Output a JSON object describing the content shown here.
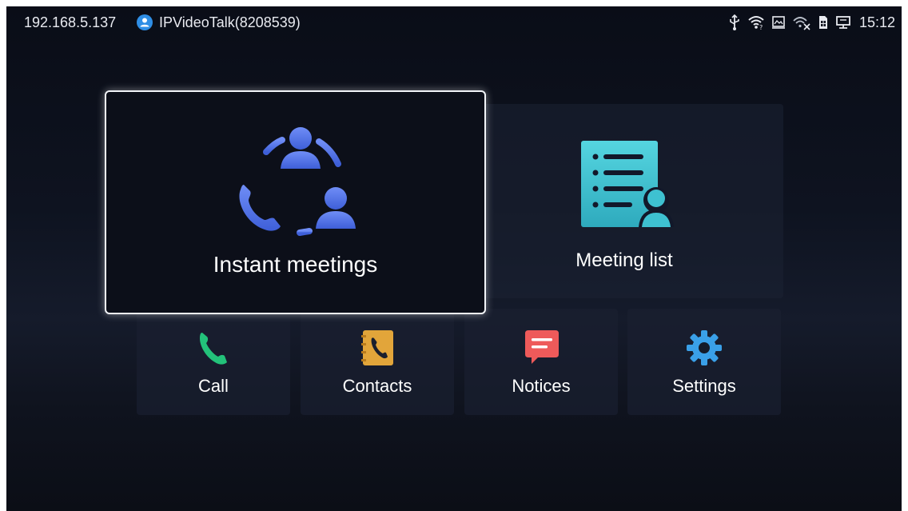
{
  "status_bar": {
    "ip_address": "192.168.5.137",
    "account_name": "IPVideoTalk(8208539)",
    "time": "15:12",
    "icons": [
      "usb-icon",
      "wifi-icon",
      "screen-icon",
      "wifi-off-icon",
      "sim-icon",
      "display-icon"
    ]
  },
  "tiles": {
    "instant_meetings": {
      "label": "Instant meetings",
      "icon": "instant-meetings-icon"
    },
    "meeting_list": {
      "label": "Meeting list",
      "icon": "meeting-list-icon"
    },
    "call": {
      "label": "Call",
      "icon": "phone-icon"
    },
    "contacts": {
      "label": "Contacts",
      "icon": "contacts-book-icon"
    },
    "notices": {
      "label": "Notices",
      "icon": "message-icon"
    },
    "settings": {
      "label": "Settings",
      "icon": "gear-icon"
    }
  },
  "colors": {
    "accent_blue": "#5b7cf0",
    "meeting_list_teal": "#3fc3d2",
    "call_green": "#23c27a",
    "contacts_gold": "#e2a53a",
    "notices_red": "#ee5a5a",
    "settings_blue": "#3aa0e8",
    "focus_border": "#f2f4f8"
  }
}
